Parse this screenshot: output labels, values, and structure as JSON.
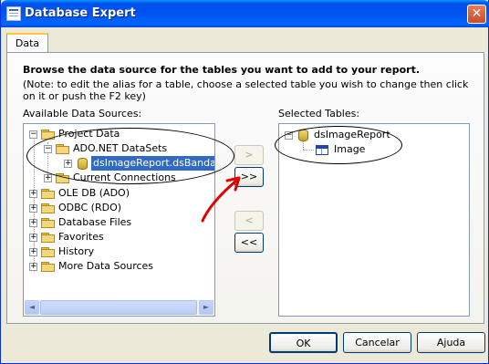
{
  "window": {
    "title": "Database Expert",
    "close_label": "✕"
  },
  "tabs": [
    {
      "label": "Data"
    }
  ],
  "instructions": {
    "heading": "Browse the data source for the tables you want to add to your report.",
    "note": "(Note: to edit the alias for a table, choose a selected table you wish to change then click on it or push the F2 key)"
  },
  "available": {
    "label": "Available Data Sources:",
    "tree": [
      {
        "label": "Project Data",
        "expander": "−",
        "icon": "folder-icon"
      },
      {
        "label": "ADO.NET DataSets",
        "expander": "−",
        "icon": "folder-icon"
      },
      {
        "label": "dsImageReport.dsBandasFa",
        "expander": "+",
        "icon": "dataset-icon",
        "selected": true
      },
      {
        "label": "Current Connections",
        "expander": "+",
        "icon": "folder-icon"
      },
      {
        "label": "OLE DB (ADO)",
        "expander": "+",
        "icon": "folder-icon"
      },
      {
        "label": "ODBC (RDO)",
        "expander": "+",
        "icon": "folder-icon"
      },
      {
        "label": "Database Files",
        "expander": "+",
        "icon": "folder-icon"
      },
      {
        "label": "Favorites",
        "expander": "+",
        "icon": "folder-icon"
      },
      {
        "label": "History",
        "expander": "+",
        "icon": "folder-icon"
      },
      {
        "label": "More Data Sources",
        "expander": "+",
        "icon": "folder-icon"
      }
    ],
    "scroll_left": "◄",
    "scroll_right": "►"
  },
  "transfer": {
    "add_one": ">",
    "add_all": ">>",
    "remove_one": "<",
    "remove_all": "<<"
  },
  "selected": {
    "label": "Selected Tables:",
    "tree": [
      {
        "label": "dsImageReport",
        "expander": "−",
        "icon": "dataset-icon"
      },
      {
        "label": "Image",
        "icon": "table-icon"
      }
    ]
  },
  "footer": {
    "ok": "OK",
    "cancel": "Cancelar",
    "help": "Ajuda"
  },
  "annotation_color": "#e00000"
}
